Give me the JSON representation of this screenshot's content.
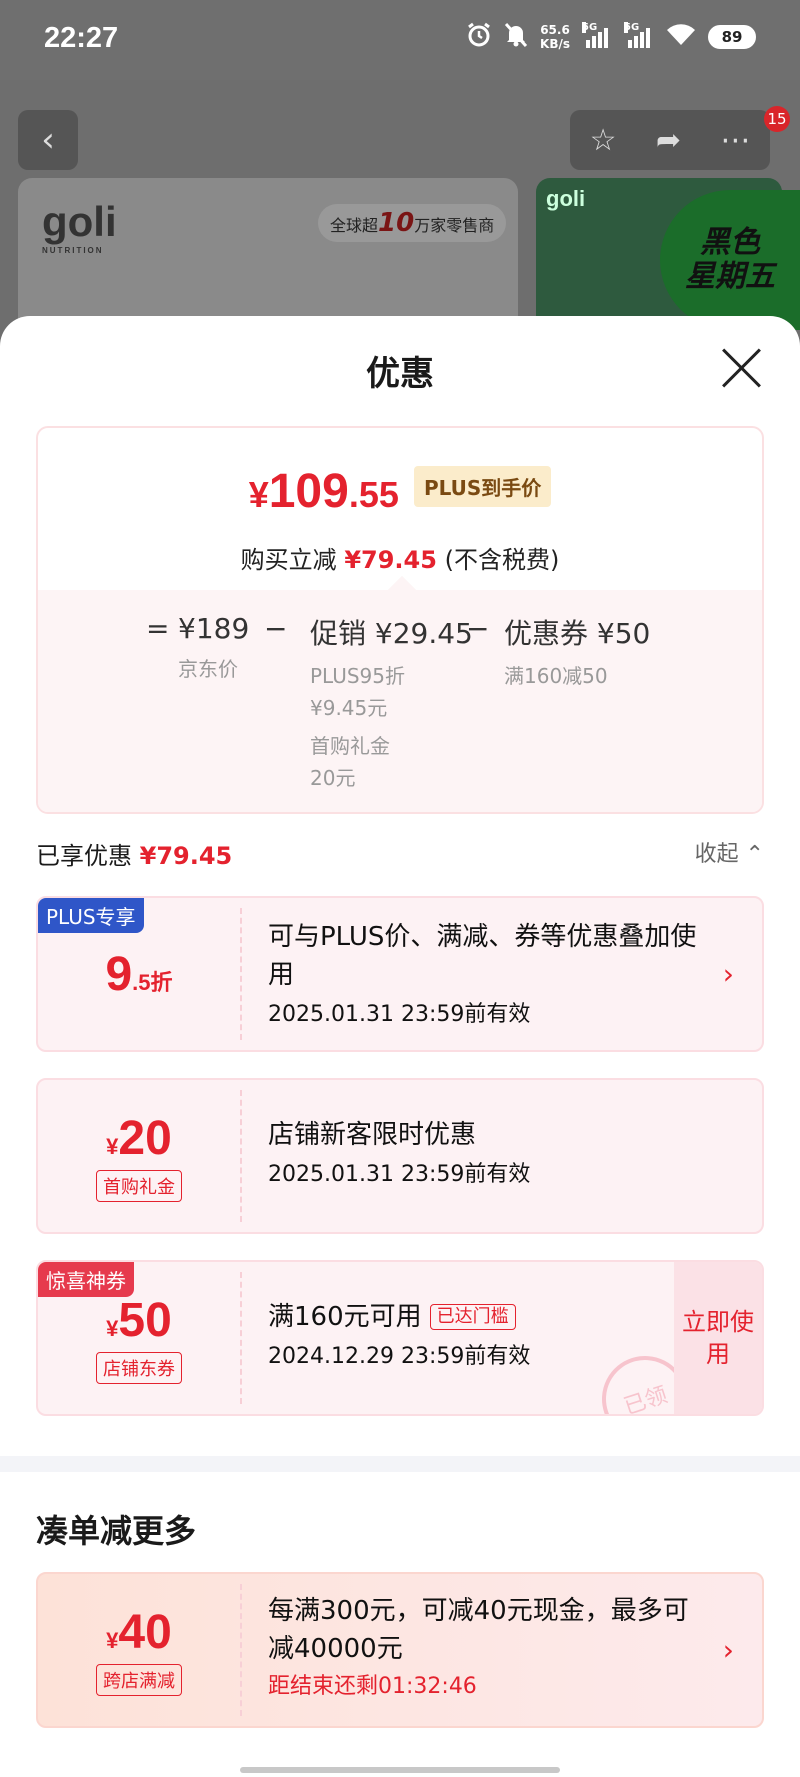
{
  "status_bar": {
    "time": "22:27",
    "net_speed_value": "65.6",
    "net_speed_unit": "KB/s",
    "signal1": "5G",
    "signal2": "5G",
    "battery": "89"
  },
  "background_page": {
    "badge_count": "15",
    "brand": "goli",
    "brand_sub": "NUTRITION",
    "slogan_prefix": "全球超",
    "slogan_number": "10",
    "slogan_suffix": "万家零售商",
    "brand2": "goli",
    "promo_line1": "黑色",
    "promo_line2": "星期五"
  },
  "sheet": {
    "title": "优惠",
    "final_price_symbol": "¥",
    "final_price_int": "109",
    "final_price_dec": ".55",
    "plus_tag": "PLUS到手价",
    "reduce_label": "购买立减",
    "reduce_amount": "¥79.45",
    "reduce_note": "(不含税费)",
    "calc": {
      "eq": "=",
      "jd_price": "¥189",
      "jd_price_label": "京东价",
      "minus1": "−",
      "promo": "促销 ¥29.45",
      "promo_detail1": "PLUS95折",
      "promo_detail2": "¥9.45元",
      "promo_detail3": "首购礼金",
      "promo_detail4": "20元",
      "minus2": "−",
      "coupon": "优惠券 ¥50",
      "coupon_detail": "满160减50"
    },
    "enjoyed_label": "已享优惠",
    "enjoyed_amount": "¥79.45",
    "collapse_label": "收起 ⌃",
    "coupons": [
      {
        "corner": "PLUS专享",
        "big": "9",
        "big_small": ".5折",
        "desc": "可与PLUS价、满减、券等优惠叠加使用",
        "valid": "2025.01.31 23:59前有效",
        "arrow": "›"
      },
      {
        "currency": "¥",
        "big": "20",
        "tag": "首购礼金",
        "desc": "店铺新客限时优惠",
        "valid": "2025.01.31 23:59前有效"
      },
      {
        "corner": "惊喜神券",
        "currency": "¥",
        "big": "50",
        "tag": "店铺东券",
        "desc": "满160元可用",
        "reach_tag": "已达门槛",
        "valid": "2024.12.29 23:59前有效",
        "use_button": "立即使用",
        "stamp": "已领"
      }
    ],
    "more_title": "凑单减更多",
    "more_coupon": {
      "currency": "¥",
      "big": "40",
      "tag": "跨店满减",
      "desc": "每满300元，可减40元现金，最多可减40000元",
      "countdown": "距结束还剩01:32:46",
      "arrow": "›"
    }
  },
  "colors": {
    "accent_red": "#e4222e",
    "plus_blue": "#2f56c8",
    "surprise_red": "#e63a4d"
  }
}
